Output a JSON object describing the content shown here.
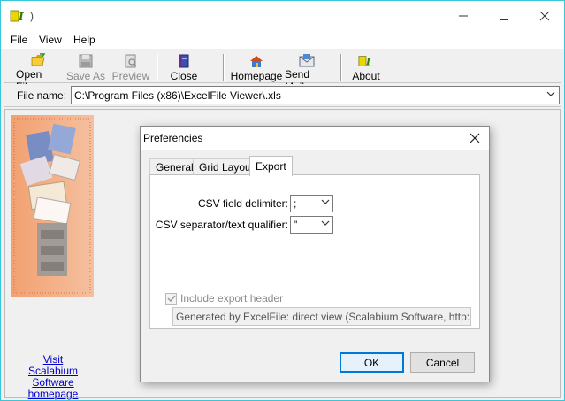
{
  "window": {
    "title": ")"
  },
  "menu": [
    "File",
    "View",
    "Help"
  ],
  "toolbar": {
    "buttons": [
      {
        "label": "Open File",
        "icon": "open-folder-icon",
        "enabled": true
      },
      {
        "label": "Save As",
        "icon": "floppy-disk-icon",
        "enabled": false
      },
      {
        "label": "Preview",
        "icon": "preview-icon",
        "enabled": false
      },
      {
        "label": "Close",
        "icon": "close-book-icon",
        "enabled": true
      },
      {
        "label": "Homepage",
        "icon": "home-icon",
        "enabled": true
      },
      {
        "label": "Send Mail",
        "icon": "mail-icon",
        "enabled": true
      },
      {
        "label": "About",
        "icon": "about-icon",
        "enabled": true
      }
    ]
  },
  "filename": {
    "label": "File name:",
    "value": "C:\\Program Files (x86)\\ExcelFile Viewer\\.xls"
  },
  "sidebar": {
    "link_line1": "Visit",
    "link_line2": "Scalabium Software",
    "link_line3": "homepage"
  },
  "dialog": {
    "title": "Preferencies",
    "tabs": [
      "General",
      "Grid Layout",
      "Export"
    ],
    "active_tab": "Export",
    "csv_delimiter_label": "CSV field delimiter:",
    "csv_delimiter_value": ";",
    "csv_qualifier_label": "CSV separator/text qualifier:",
    "csv_qualifier_value": "\"",
    "include_header_label": "Include export header",
    "include_header_checked": true,
    "header_text": "Generated by ExcelFile: direct view (Scalabium Software, http://www.",
    "ok_label": "OK",
    "cancel_label": "Cancel"
  },
  "colors": {
    "window_border": "#39c6d6",
    "default_button_border": "#0078d7",
    "link": "#0000cc"
  }
}
